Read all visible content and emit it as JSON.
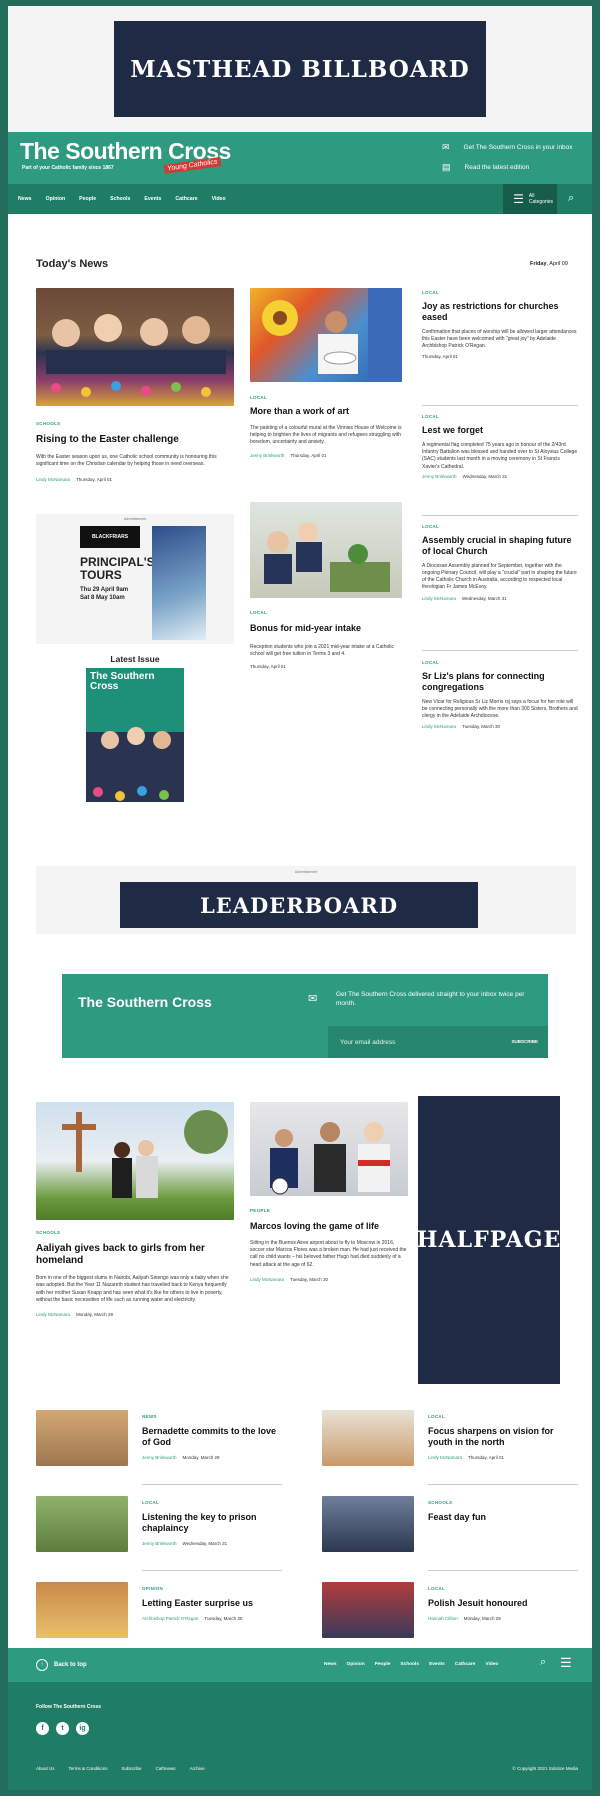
{
  "ads": {
    "masthead": "MASTHEAD BILLBOARD",
    "advertisement": "Advertisement",
    "leaderboard": "LEADERBOARD",
    "halfpage": "HALFPAGE",
    "inline": {
      "brand": "BLACKFRIARS",
      "title_line1": "PRINCIPAL'S",
      "title_line2": "TOURS",
      "when1": "Thu 29 April 9am",
      "when2": "Sat 8 May 10am"
    }
  },
  "header": {
    "title": "The Southern Cross",
    "tagline": "Part of your Catholic family since 1867",
    "script": "Young Catholics",
    "newsletter_cta": "Get The Southern Cross in your inbox",
    "read_cta": "Read the latest edition"
  },
  "nav": {
    "items": [
      "News",
      "Opinion",
      "People",
      "Schools",
      "Events",
      "Cathcare",
      "Video"
    ],
    "all_categories": "All Categories"
  },
  "section": {
    "title": "Today's News",
    "day": "Friday",
    "date": "April 09"
  },
  "featured": [
    {
      "category": "SCHOOLS",
      "headline": "Rising to the Easter challenge",
      "excerpt": "With the Easter season upon us, one Catholic school community is honouring this significant time on the Christian calendar by helping those in need overseas.",
      "author": "Lindy McNamara",
      "date": "Thursday, April 01"
    },
    {
      "category": "LOCAL",
      "headline": "More than a work of art",
      "excerpt": "The painting of a colourful mural at the Vinnies House of Welcome is helping to brighten the lives of migrants and refugees struggling with boredom, uncertainty and anxiety.",
      "author": "Jenny Brinkworth",
      "date": "Thursday, April 01"
    },
    {
      "category": "LOCAL",
      "headline": "Bonus for mid-year intake",
      "excerpt": "Reception students who join a 2021 mid-year intake at a Catholic school will get free tuition in Terms 3 and 4.",
      "author": "",
      "date": "Thursday, April 01"
    }
  ],
  "right_list": [
    {
      "category": "LOCAL",
      "headline": "Joy as restrictions for churches eased",
      "excerpt": "Confirmation that places of worship will be allowed larger attendances this Easter have been welcomed with \"great joy\" by Adelaide Archbishop Patrick O'Regan.",
      "author": "",
      "date": "Thursday, April 01"
    },
    {
      "category": "LOCAL",
      "headline": "Lest we forget",
      "excerpt": "A regimental flag completed 75 years ago in honour of the 2/43rd Infantry Battalion was blessed and handed over to St Aloysius College (SAC) students last month in a moving ceremony in St Francis Xavier's Cathedral.",
      "author": "Jenny Brinkworth",
      "date": "Wednesday, March 31"
    },
    {
      "category": "LOCAL",
      "headline": "Assembly crucial in shaping future of local Church",
      "excerpt": "A Diocesan Assembly planned for September, together with the ongoing Plenary Council, will play a \"crucial\" part in shaping the future of the Catholic Church in Australia, according to respected local theologian Fr James McEvoy.",
      "author": "Lindy McNamara",
      "date": "Wednesday, March 31"
    },
    {
      "category": "LOCAL",
      "headline": "Sr Liz's plans for connecting congregations",
      "excerpt": "New Vicar for Religious Sr Liz Morris rsj says a focus for her role will be connecting personally with the more than 300 Sisters, Brothers and clergy in the Adelaide Archdiocese.",
      "author": "Lindy McNamara",
      "date": "Tuesday, March 30"
    }
  ],
  "latest_issue": {
    "label": "Latest Issue",
    "cover_title": "The Southern Cross"
  },
  "newsletter": {
    "title": "The Southern Cross",
    "text": "Get The Southern Cross delivered straight to your inbox twice per month.",
    "placeholder": "Your email address",
    "button": "SUBSCRIBE"
  },
  "second": [
    {
      "category": "SCHOOLS",
      "headline": "Aaliyah gives back to girls from her homeland",
      "excerpt": "Born in one of the biggest slums in Nairobi, Aaliyah Sinengo was only a baby when she was adopted. But the Year 11 Nazareth student has travelled back to Kenya frequently with her mother Susan Knapp and has seen what it's like for others to live in poverty, without the basic necessities of life such as running water and electricity.",
      "author": "Lindy McNamara",
      "date": "Monday, March 29"
    },
    {
      "category": "PEOPLE",
      "headline": "Marcos loving the game of life",
      "excerpt": "Sitting in the Buenos Aires airport about to fly to Moscow in 2016, soccer star Marcos Flores was a broken man. He had just received the call no child wants – his beloved father Hugo had died suddenly of a heart attack at the age of 62.",
      "author": "Lindy McNamara",
      "date": "Tuesday, March 30"
    }
  ],
  "small_list": [
    {
      "category": "NEWS",
      "headline": "Bernadette commits to the love of God",
      "author": "Jenny Brinkworth",
      "date": "Monday, March 29"
    },
    {
      "category": "LOCAL",
      "headline": "Focus sharpens on vision for youth in the north",
      "author": "Lindy McNamara",
      "date": "Thursday, April 01"
    },
    {
      "category": "LOCAL",
      "headline": "Listening the key to prison chaplaincy",
      "author": "Jenny Brinkworth",
      "date": "Wednesday, March 31"
    },
    {
      "category": "SCHOOLS",
      "headline": "Feast day fun",
      "author": "",
      "date": ""
    },
    {
      "category": "OPINION",
      "headline": "Letting Easter surprise us",
      "author": "Archbishop Patrick O'Regan",
      "date": "Tuesday, March 30"
    },
    {
      "category": "LOCAL",
      "headline": "Polish Jesuit honoured",
      "author": "Hannah Clifton",
      "date": "Monday, March 29"
    }
  ],
  "footer": {
    "back_to_top": "Back to top",
    "nav": [
      "News",
      "Opinion",
      "People",
      "Schools",
      "Events",
      "Cathcare",
      "Video"
    ],
    "follow": "Follow The Southern Cross",
    "socials": [
      "f",
      "t",
      "ig"
    ],
    "links": [
      "About Us",
      "Terms & Conditions",
      "Subscribe",
      "Cathnews",
      "Archive"
    ],
    "copyright": "© Copyright 2021 Solstice Media"
  },
  "colors": {
    "brand": "#2e9a80",
    "nav": "#1f7d66",
    "ad": "#1f2a44"
  }
}
